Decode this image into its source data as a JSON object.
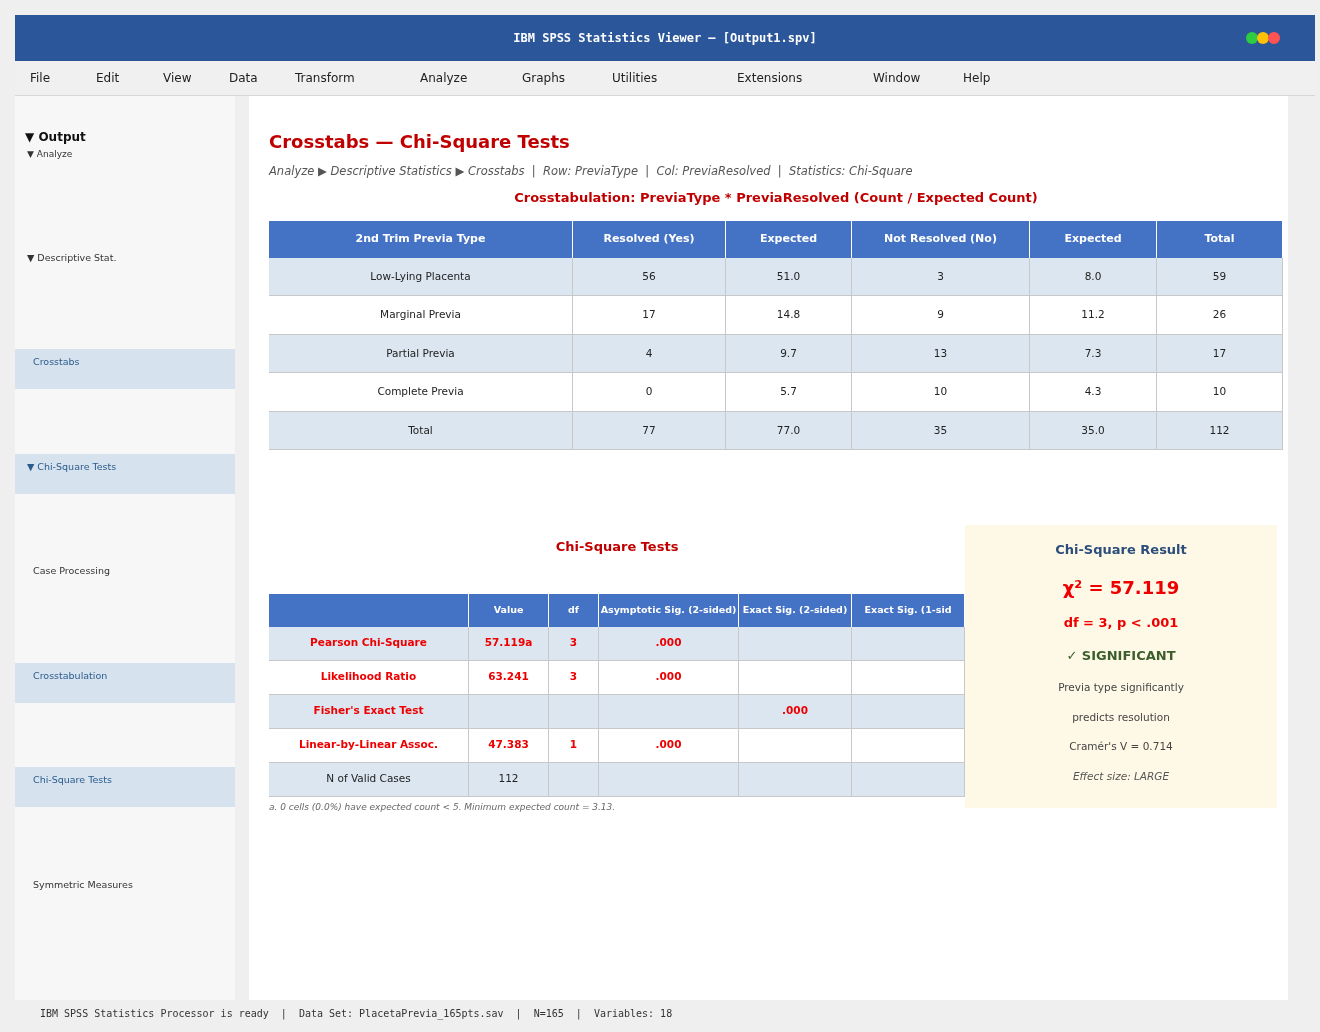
{
  "window": {
    "title": "IBM SPSS Statistics Viewer — [Output1.spv]"
  },
  "menu": [
    "File",
    "Edit",
    "View",
    "Data",
    "Transform",
    "Analyze",
    "Graphs",
    "Utilities",
    "Extensions",
    "Window",
    "Help"
  ],
  "outline": [
    {
      "label": "▼ Output",
      "selected": false,
      "children": [
        {
          "label": "▼ Analyze",
          "selected": false,
          "children": [
            {
              "label": "▼ Descriptive Stat.",
              "selected": false,
              "children": [
                {
                  "label": "Crosstabs",
                  "selected": true
                },
                {
                  "label": "▼ Chi-Square Tests",
                  "selected": true,
                  "children": [
                    {
                      "label": "Case Processing",
                      "selected": false
                    },
                    {
                      "label": "Crosstabulation",
                      "selected": true
                    },
                    {
                      "label": "Chi-Square Tests",
                      "selected": true
                    },
                    {
                      "label": "Symmetric Measures",
                      "selected": false
                    }
                  ]
                }
              ]
            }
          ]
        }
      ]
    }
  ],
  "heading": "Crosstabs — Chi-Square Tests",
  "breadcrumb": "Analyze ▶ Descriptive Statistics ▶ Crosstabs  |  Row: PreviaType  |  Col: PreviaResolved  |  Statistics: Chi-Square",
  "crosstab": {
    "title": "Crosstabulation: PreviaType * PreviaResolved  (Count / Expected Count)",
    "columns": [
      "2nd Trim Previa Type",
      "Resolved (Yes)",
      "Expected",
      "Not Resolved (No)",
      "Expected",
      "Total"
    ],
    "rows": [
      [
        "Low-Lying Placenta",
        "56",
        "51.0",
        "3",
        "8.0",
        "59"
      ],
      [
        "Marginal Previa",
        "17",
        "14.8",
        "9",
        "11.2",
        "26"
      ],
      [
        "Partial Previa",
        "4",
        "9.7",
        "13",
        "7.3",
        "17"
      ],
      [
        "Complete Previa",
        "0",
        "5.7",
        "10",
        "4.3",
        "10"
      ],
      [
        "Total",
        "77",
        "77.0",
        "35",
        "35.0",
        "112"
      ]
    ]
  },
  "chi_square": {
    "title": "Chi-Square Tests",
    "columns": [
      "",
      "Value",
      "df",
      "Asymptotic Sig. (2-sided)",
      "Exact Sig. (2-sided)",
      "Exact Sig. (1-sid"
    ],
    "rows": [
      {
        "highlighted": true,
        "cells": [
          "Pearson Chi-Square",
          "57.119a",
          "3",
          ".000",
          "",
          ""
        ]
      },
      {
        "highlighted": true,
        "cells": [
          "Likelihood Ratio",
          "63.241",
          "3",
          ".000",
          "",
          ""
        ]
      },
      {
        "highlighted": true,
        "cells": [
          "Fisher's Exact Test",
          "",
          "",
          "",
          ".000",
          ""
        ]
      },
      {
        "highlighted": true,
        "cells": [
          "Linear-by-Linear Assoc.",
          "47.383",
          "1",
          ".000",
          "",
          ""
        ]
      },
      {
        "highlighted": false,
        "cells": [
          "N of Valid Cases",
          "112",
          "",
          "",
          "",
          ""
        ]
      }
    ],
    "footnote": "a. 0 cells (0.0%) have expected count < 5.  Minimum expected count = 3.13."
  },
  "result": {
    "title": "Chi-Square Result",
    "statistic": "χ² = 57.119",
    "detail": "df = 3,  p < .001",
    "verdict": "✓  SIGNIFICANT",
    "lines": [
      "Previa type significantly",
      "predicts resolution",
      "Cramér's V = 0.714"
    ],
    "effect": "Effect size: LARGE"
  },
  "status_bar": "IBM SPSS Statistics Processor is ready  |  Data Set: PlacetaPrevia_165pts.sav  |  N=165  |  Variables: 18"
}
